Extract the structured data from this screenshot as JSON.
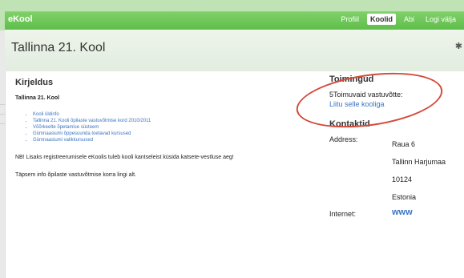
{
  "app": {
    "brand": "eKool"
  },
  "nav": {
    "items": [
      "Profiil",
      "Koolid",
      "Abi",
      "Logi välja"
    ],
    "active_index": 1
  },
  "header": {
    "title": "Tallinna 21. Kool"
  },
  "kirjeldus": {
    "heading": "Kirjeldus",
    "school_name": "Tallinna 21. Kool",
    "links": [
      "Kooli üldinfo",
      "Tallinna 21. Kooli õpilaste vastuvõtmise kord 2010/2011",
      "Võõrkeelte õpetamise süsteem",
      "Gümnaasiumi õppesuunda toetavad kursused",
      "Gümnaasiumi valikkursused"
    ],
    "note": "NB! Lisaks registreerumisele eKoolis tuleb kooli kantseleist küsida katsete-vestluse aeg!",
    "note2": "Täpsem info õpilaste vastuvõtmise korra lingi alt."
  },
  "toimingud": {
    "heading": "Toimingud",
    "text": "5Toimuvaid vastuvõtte:",
    "link": "Liitu selle kooliga"
  },
  "kontaktid": {
    "heading": "Kontaktid",
    "address_label": "Address:",
    "address_lines": [
      "Raua 6",
      "Tallinn Harjumaa",
      "10124",
      "Estonia"
    ],
    "internet_label": "Internet:",
    "internet_link": "www"
  },
  "colors": {
    "nav_green": "#5fbe4a",
    "link_blue": "#3b74c2",
    "highlight_red": "#d24a3a"
  }
}
